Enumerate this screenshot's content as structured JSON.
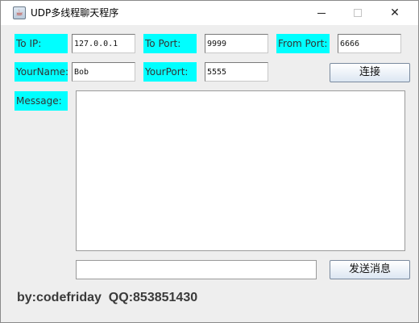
{
  "window": {
    "title": "UDP多线程聊天程序",
    "icon": "java-app-icon",
    "controls": {
      "minimize": "—",
      "maximize": "□",
      "close": "✕"
    }
  },
  "colors": {
    "label_bg": "#00ffff",
    "window_bg": "#eeeeee"
  },
  "form": {
    "to_ip_label": "To IP:",
    "to_ip_value": "127.0.0.1",
    "to_port_label": "To Port:",
    "to_port_value": "9999",
    "from_port_label": "From Port:",
    "from_port_value": "6666",
    "your_name_label": "YourName:",
    "your_name_value": "Bob",
    "your_port_label": "YourPort:",
    "your_port_value": "5555",
    "connect_button": "连接",
    "message_label": "Message:",
    "message_area": "",
    "input_value": "",
    "send_button": "发送消息"
  },
  "footer": {
    "text": "by:codefriday  QQ:853851430"
  }
}
